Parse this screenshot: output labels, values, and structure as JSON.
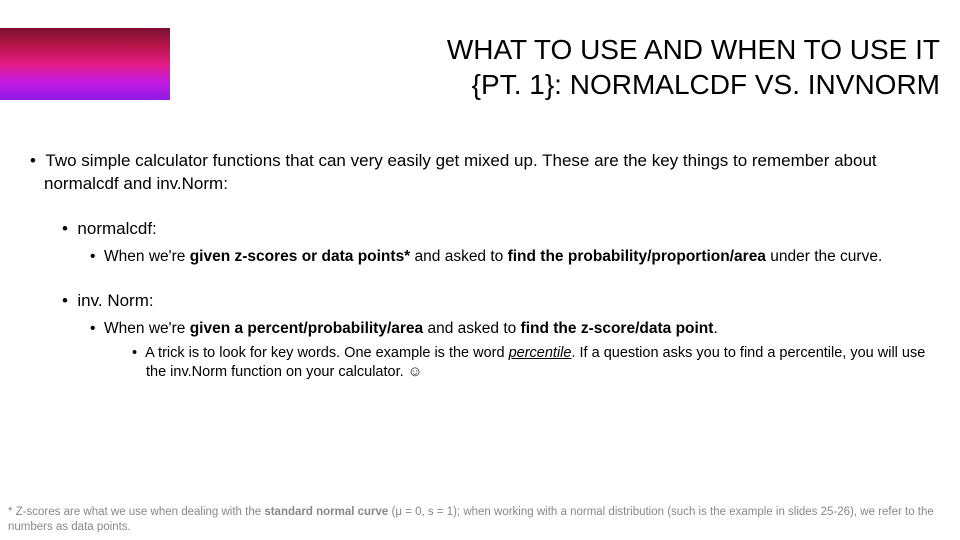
{
  "title": {
    "line1": "WHAT TO USE AND WHEN TO USE IT",
    "line2": "{PT. 1}: NORMALCDF VS. INVNORM"
  },
  "intro": "Two simple calculator functions that can very easily get mixed up. These are the key things to remember about normalcdf and inv.Norm:",
  "s1": {
    "head": "normalcdf:",
    "t1a": "When we're ",
    "t1b": "given z-scores or data points*",
    "t1c": " and asked to ",
    "t1d": "find the probability/proportion/area",
    "t1e": " under the curve."
  },
  "s2": {
    "head": "inv. Norm:",
    "t1a": "When we're ",
    "t1b": "given a percent/probability/area",
    "t1c": " and asked to ",
    "t1d": "find the z-score/data point",
    "t1e": ".",
    "t2a": "A trick is to look for key words. One example is the word ",
    "t2b": "percentile",
    "t2c": ". If a question asks you to find a percentile, you will use the inv.Norm function on your calculator. ☺"
  },
  "foot": {
    "a": "* Z-scores are what we use when dealing with the ",
    "b": "standard normal curve",
    "c": " (μ = 0, s = 1); when working with a normal distribution (such is the example in slides 25-26), we refer to the numbers as data points."
  }
}
